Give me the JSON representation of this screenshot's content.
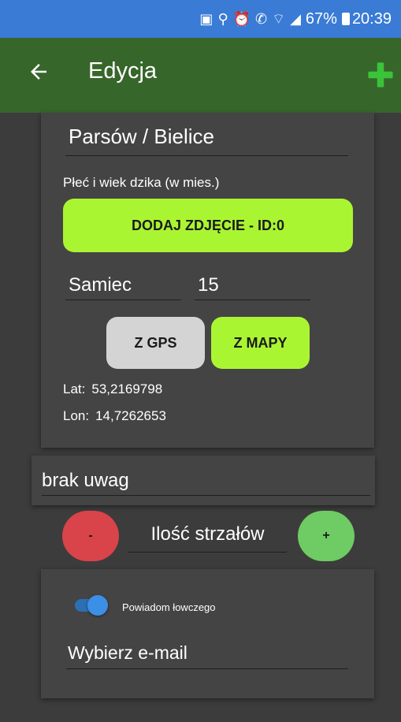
{
  "status_bar": {
    "battery": "67%",
    "time": "20:39",
    "icons": [
      "sim-icon",
      "location-icon",
      "alarm-icon",
      "call-icon",
      "wifi-icon",
      "signal-icon",
      "battery-icon"
    ]
  },
  "app_bar": {
    "title": "Edycja",
    "back_icon": "arrow-left-icon",
    "add_icon": "plus-icon",
    "add_color": "#39c439"
  },
  "form": {
    "place": "Parsów / Bielice",
    "section_label": "Płeć i wiek dzika (w mies.)",
    "add_photo_button": "DODAJ ZDJĘCIE - ID:0",
    "sex": "Samiec",
    "age": "15",
    "gps_button": "Z GPS",
    "map_button": "Z MAPY",
    "lat_label": "Lat:",
    "lat_value": "53,2169798",
    "lon_label": "Lon:",
    "lon_value": "14,7262653",
    "notes": "brak uwag",
    "minus_button": "-",
    "shots_placeholder": "Ilość strzałów",
    "plus_button": "+",
    "notify_label": "Powiadom łowczego",
    "notify_enabled": true,
    "email_placeholder": "Wybierz e-mail"
  },
  "colors": {
    "status_bar": "#3a7bd5",
    "app_bar": "#37662a",
    "accent_green": "#aaf532",
    "minus_red": "#d9434a",
    "plus_green": "#6fcb63",
    "toggle_blue": "#3c8fe6"
  }
}
